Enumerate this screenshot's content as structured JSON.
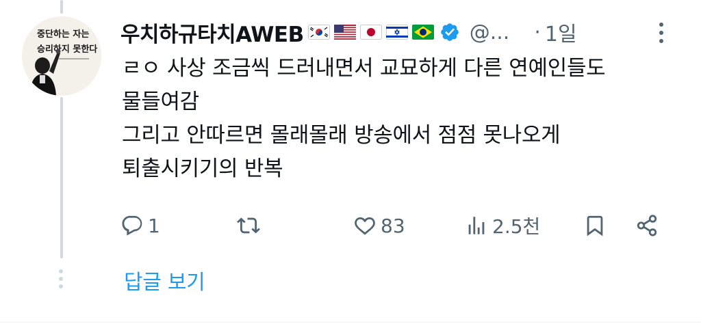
{
  "tweet": {
    "display_name": "우치하규타치AWEB",
    "flags": [
      "south-korea-flag",
      "usa-flag",
      "japan-flag",
      "israel-flag",
      "brazil-flag"
    ],
    "handle": "@...",
    "separator": "·",
    "time": "1일",
    "avatar_text_top": "중단하는 자는",
    "avatar_text_bottom": "승리하지 못한다",
    "body_lines": [
      "ㄹㅇ 사상 조금씩 드러내면서 교묘하게 다른 연예인들도",
      "물들여감",
      "그리고 안따르면 몰래몰래 방송에서 점점 못나오게",
      "퇴출시키기의 반복"
    ]
  },
  "actions": {
    "reply_count": "1",
    "retweet_count": "",
    "like_count": "83",
    "views_count": "2.5천"
  },
  "show_replies_label": "답글 보기",
  "colors": {
    "verified": "#1d9bf0",
    "link": "#1d9bf0",
    "muted": "#536471",
    "thread": "#cfd9de"
  }
}
